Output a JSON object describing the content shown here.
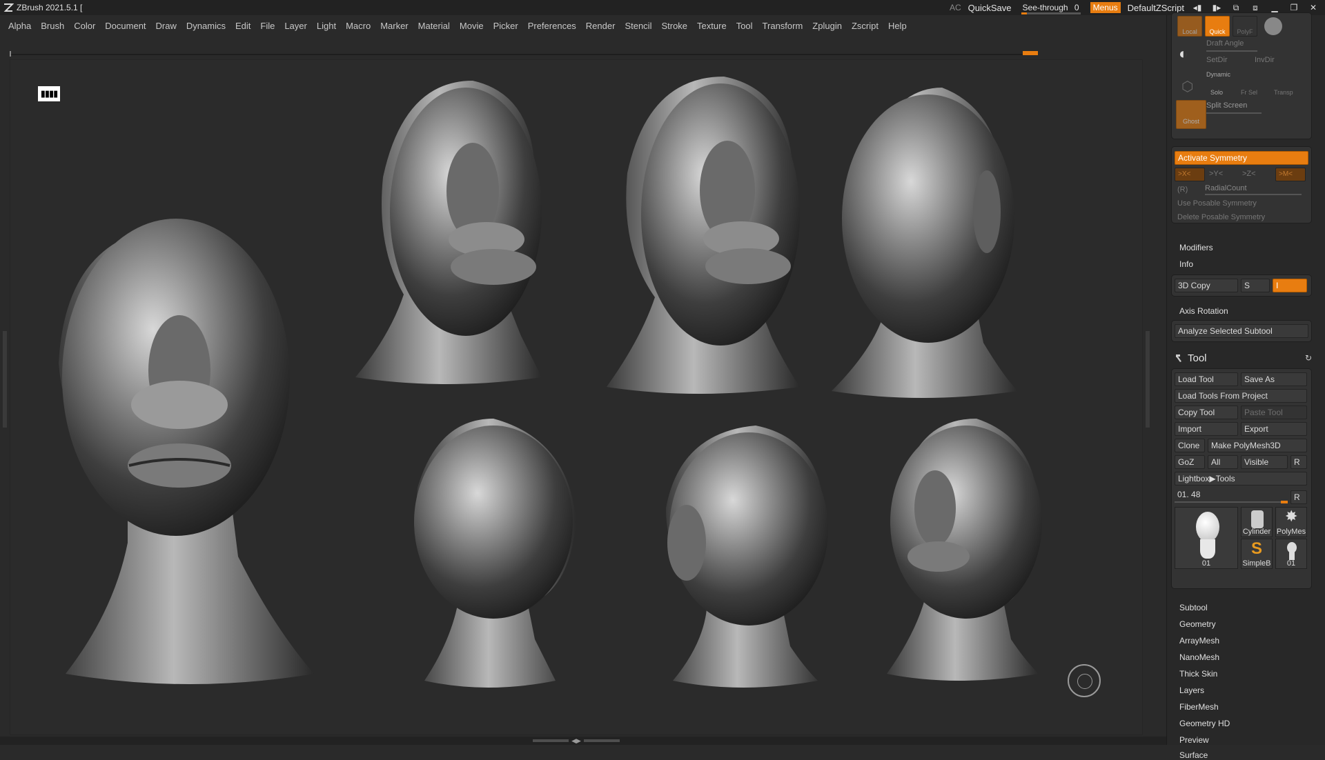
{
  "titlebar": {
    "app_title": "ZBrush 2021.5.1 [",
    "ac": "AC",
    "quicksave": "QuickSave",
    "seethrough": "See-through",
    "seethrough_value": "0",
    "menus": "Menus",
    "script": "DefaultZScript"
  },
  "menubar": [
    "Alpha",
    "Brush",
    "Color",
    "Document",
    "Draw",
    "Dynamics",
    "Edit",
    "File",
    "Layer",
    "Light",
    "Macro",
    "Marker",
    "Material",
    "Movie",
    "Picker",
    "Preferences",
    "Render",
    "Stencil",
    "Stroke",
    "Texture",
    "Tool",
    "Transform",
    "Zplugin",
    "Zscript",
    "Help"
  ],
  "viewport": {
    "icon_glyph": "▮▮▮▮"
  },
  "panel": {
    "top_buttons": {
      "local": "Local",
      "quick": "Quick",
      "polyf": "PolyF",
      "draft_angle": "Draft Angle",
      "setdir": "SetDir",
      "invdir": "InvDir",
      "dynamic": "Dynamic",
      "solo": "Solo",
      "frsel": "Fr Sel",
      "transp": "Transp",
      "split_screen": "Split Screen",
      "ghost": "Ghost"
    },
    "symmetry": {
      "activate": "Activate Symmetry",
      "x": ">X<",
      "y": ">Y<",
      "z": ">Z<",
      "m": ">M<",
      "r": "(R)",
      "radial": "RadialCount",
      "use_posable": "Use Posable Symmetry",
      "delete_posable": "Delete Posable Symmetry"
    },
    "modifiers": "Modifiers",
    "info": "Info",
    "copy3d": "3D Copy",
    "copy_s": "S",
    "copy_i": "I",
    "axis_rotation": "Axis Rotation",
    "analyze": "Analyze Selected Subtool",
    "tool": {
      "title": "Tool",
      "load_tool": "Load Tool",
      "save_as": "Save As",
      "load_from_project": "Load Tools From Project",
      "copy_tool": "Copy Tool",
      "paste_tool": "Paste Tool",
      "import": "Import",
      "export": "Export",
      "clone": "Clone",
      "make_polymesh": "Make PolyMesh3D",
      "goz": "GoZ",
      "all": "All",
      "visible": "Visible",
      "r": "R",
      "lightbox_tools": "Lightbox▶Tools",
      "current_tool_value": "01. 48",
      "current_tool_r": "R",
      "thumbs": {
        "main": "01",
        "cylinder": "Cylinder",
        "polymesh": "PolyMes",
        "simpleb": "SimpleB",
        "small": "01"
      }
    },
    "subpalettes": [
      "Subtool",
      "Geometry",
      "ArrayMesh",
      "NanoMesh",
      "Thick Skin",
      "Layers",
      "FiberMesh",
      "Geometry HD",
      "Preview",
      "Surface"
    ]
  },
  "colors": {
    "accent": "#e87d10",
    "bg": "#2a2a2a",
    "panel": "#333333"
  }
}
